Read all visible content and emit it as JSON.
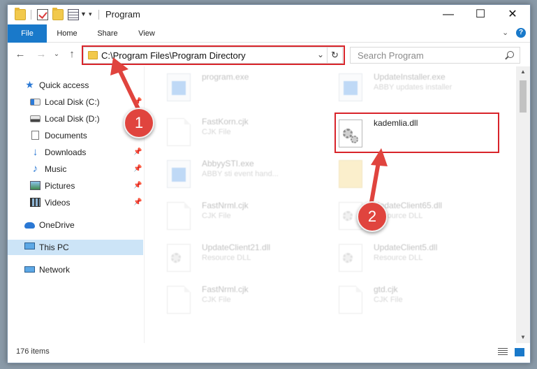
{
  "window": {
    "title": "Program",
    "minimize": "—",
    "maximize": "☐",
    "close": "✕"
  },
  "ribbon": {
    "tabs": [
      "File",
      "Home",
      "Share",
      "View"
    ],
    "expand_glyph": "⌄",
    "help_glyph": "?"
  },
  "navigation": {
    "back": "←",
    "forward": "→",
    "recent": "⌄",
    "up": "↑",
    "address": "C:\\Program Files\\Program Directory",
    "address_dropdown": "⌄",
    "refresh": "↻",
    "search_placeholder": "Search Program"
  },
  "sidebar": {
    "items": [
      {
        "label": "Quick access",
        "icon": "star-icon"
      },
      {
        "label": "Local Disk (C:)",
        "icon": "drive-icon",
        "pinned": true
      },
      {
        "label": "Local Disk (D:)",
        "icon": "drive-icon",
        "pinned": false
      },
      {
        "label": "Documents",
        "icon": "documents-icon",
        "pinned": false
      },
      {
        "label": "Downloads",
        "icon": "downloads-icon",
        "pinned": true
      },
      {
        "label": "Music",
        "icon": "music-icon",
        "pinned": true
      },
      {
        "label": "Pictures",
        "icon": "pictures-icon",
        "pinned": true
      },
      {
        "label": "Videos",
        "icon": "videos-icon",
        "pinned": true
      },
      {
        "label": "OneDrive",
        "icon": "onedrive-icon"
      },
      {
        "label": "This PC",
        "icon": "computer-icon",
        "selected": true
      },
      {
        "label": "Network",
        "icon": "network-icon"
      }
    ]
  },
  "files": [
    {
      "name": "program.exe",
      "type": "",
      "kind": "exe"
    },
    {
      "name": "UpdateInstaller.exe",
      "type": "ABBY updates installer",
      "kind": "exe"
    },
    {
      "name": "FastKorn.cjk",
      "type": "CJK File",
      "kind": "doc"
    },
    {
      "name": "kademlia.dll",
      "type": "",
      "kind": "dll",
      "highlighted": true
    },
    {
      "name": "AbbyySTI.exe",
      "type": "ABBY sti event hand...",
      "kind": "exe"
    },
    {
      "name": "",
      "type": "",
      "kind": "folder"
    },
    {
      "name": "FastNrml.cjk",
      "type": "CJK File",
      "kind": "doc"
    },
    {
      "name": "UpdateClient65.dll",
      "type": "Resource DLL",
      "kind": "dll"
    },
    {
      "name": "UpdateClient21.dll",
      "type": "Resource DLL",
      "kind": "dll"
    },
    {
      "name": "UpdateClient5.dll",
      "type": "Resource DLL",
      "kind": "dll"
    },
    {
      "name": "FastNrml.cjk",
      "type": "CJK File",
      "kind": "doc"
    },
    {
      "name": "gtd.cjk",
      "type": "CJK File",
      "kind": "doc"
    }
  ],
  "status": {
    "item_count": "176 items"
  },
  "callouts": [
    "1",
    "2"
  ],
  "colors": {
    "accent": "#1979ca",
    "highlight": "#d8242a",
    "callout": "#e0443e",
    "selection": "#cce4f7"
  }
}
